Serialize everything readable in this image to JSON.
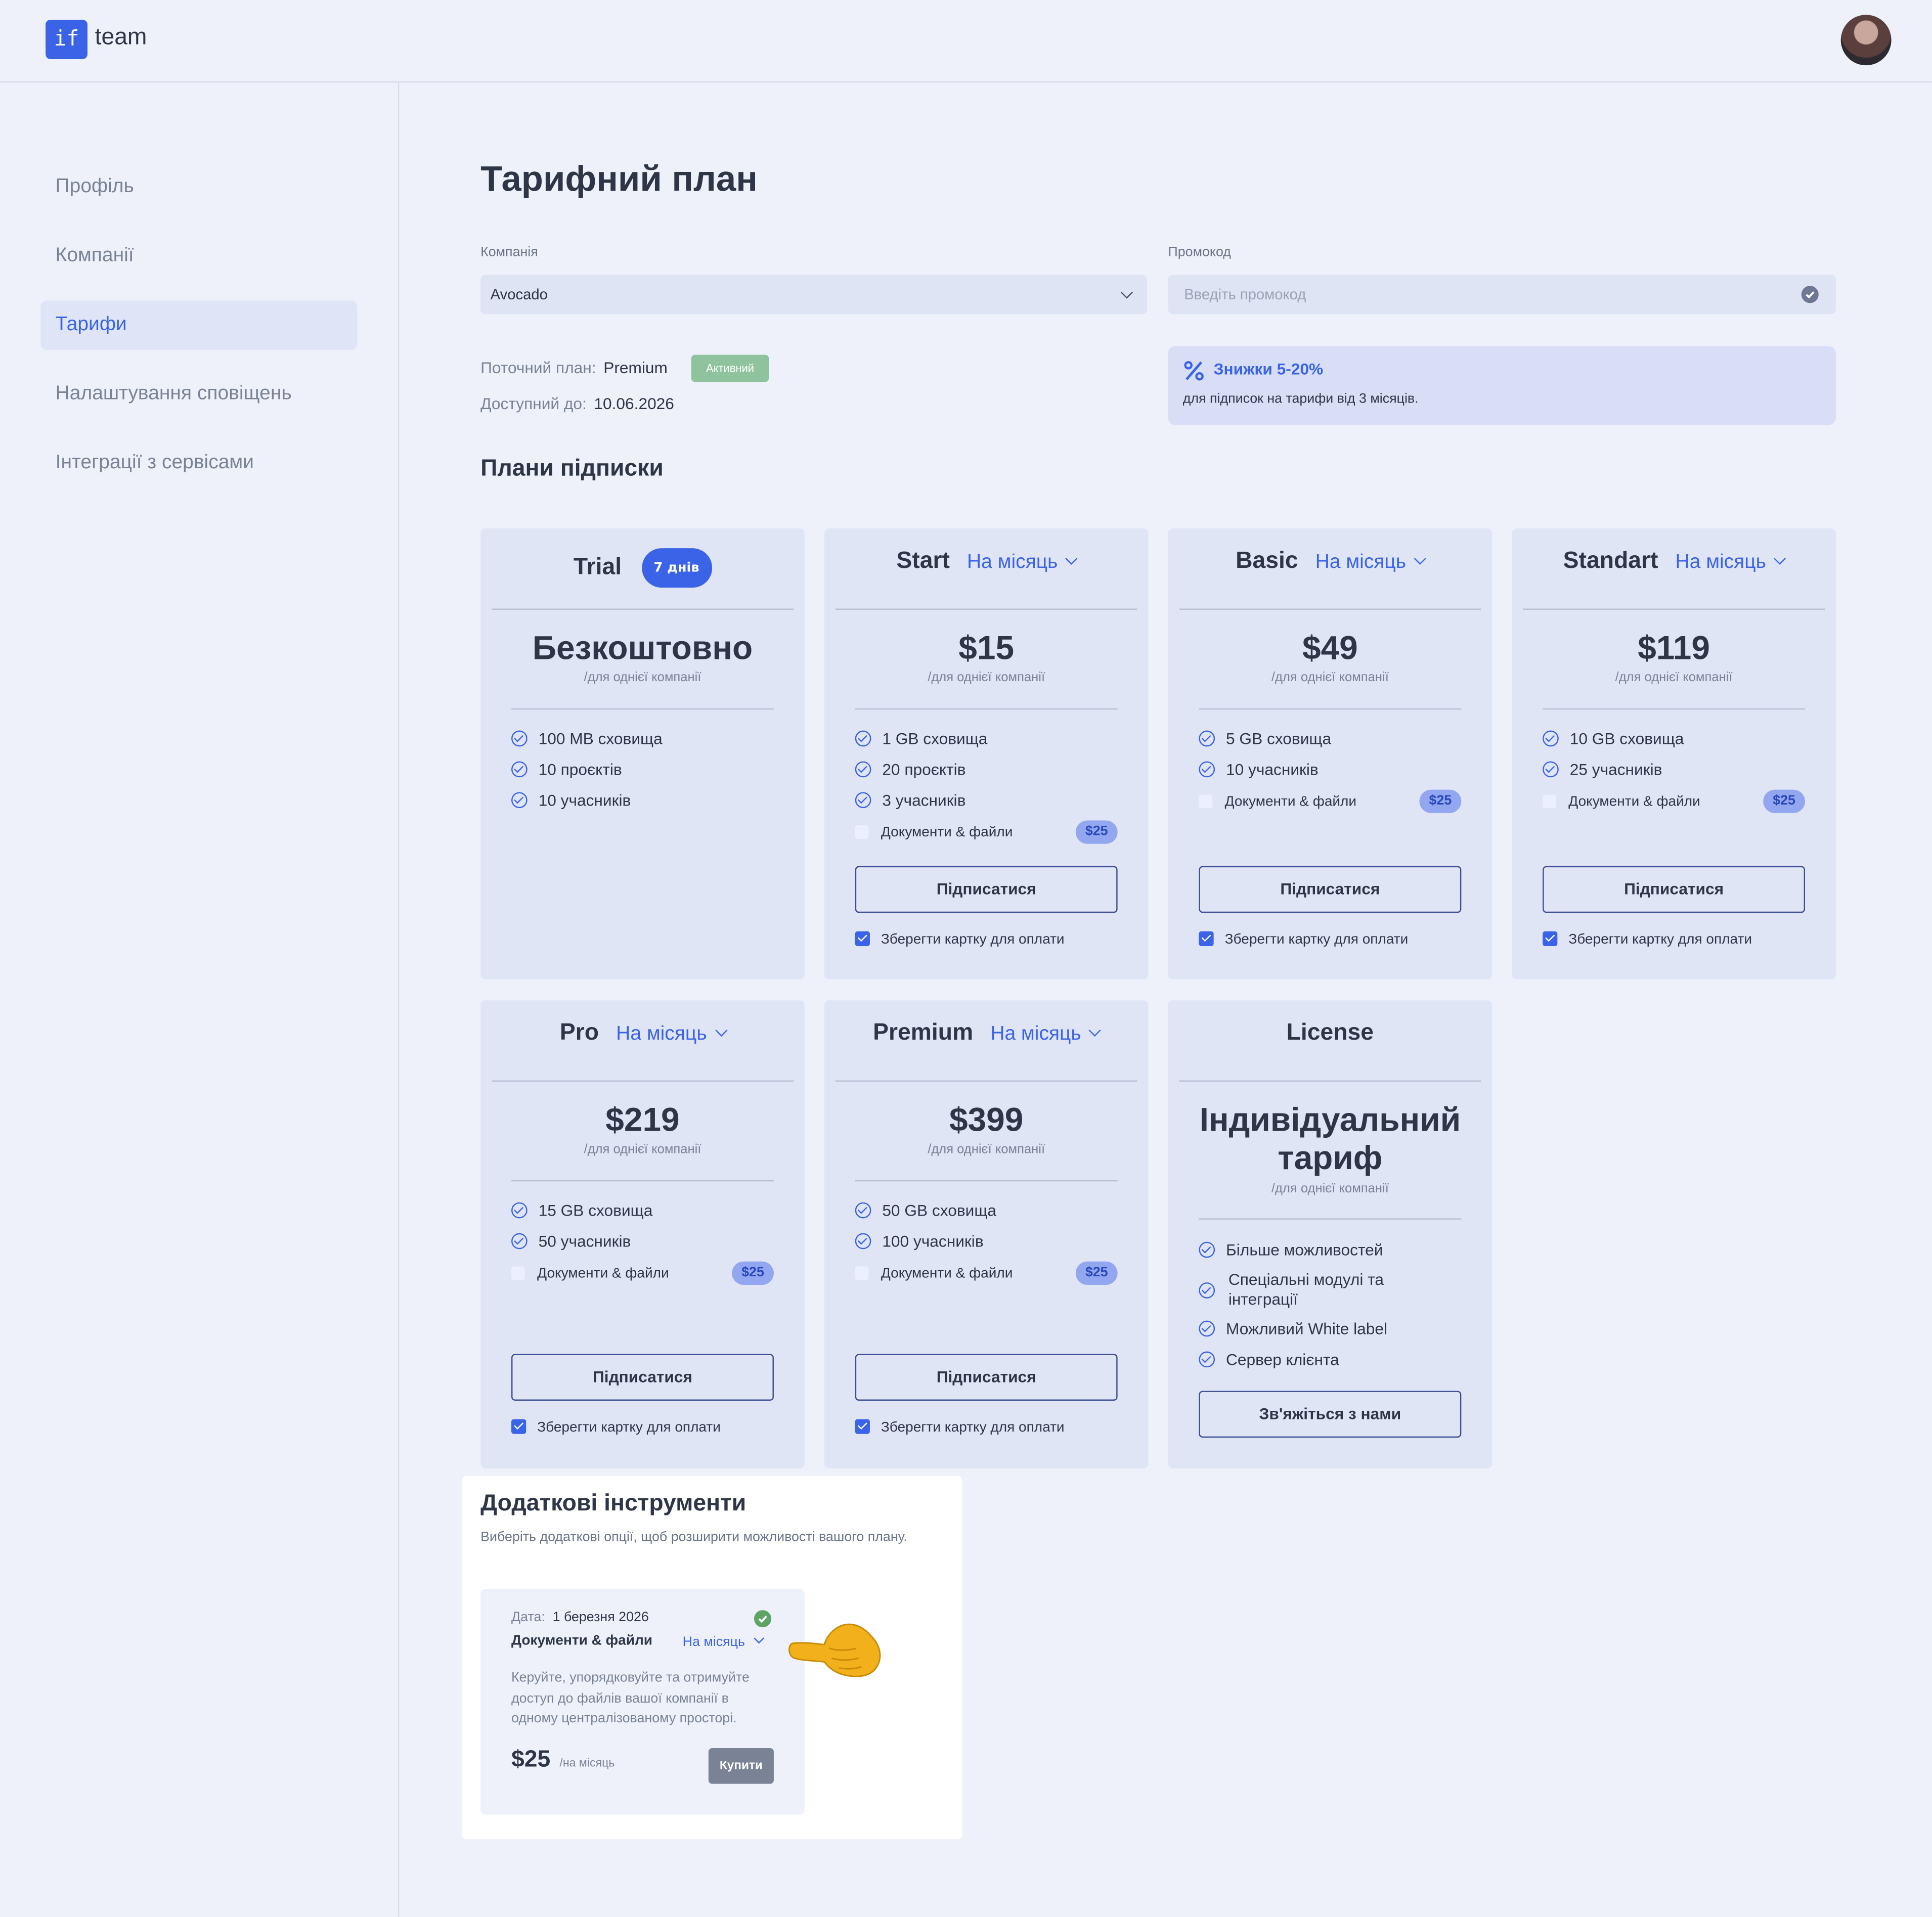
{
  "header": {
    "logo_mark": "if",
    "logo_text": "team"
  },
  "sidebar": {
    "items": [
      {
        "label": "Профіль"
      },
      {
        "label": "Компанії"
      },
      {
        "label": "Тарифи"
      },
      {
        "label": "Налаштування сповіщень"
      },
      {
        "label": "Інтеграції з сервісами"
      }
    ]
  },
  "main": {
    "title": "Тарифний план",
    "company_label": "Компанія",
    "company_value": "Avocado",
    "promo_label": "Промокод",
    "promo_placeholder": "Введіть промокод",
    "current_plan_label": "Поточний план:",
    "current_plan_value": "Premium",
    "active_badge": "Активний",
    "available_label": "Доступний до:",
    "available_value": "10.06.2026",
    "discount_title": "Знижки 5-20%",
    "discount_text": "для підписок на тарифи від 3 місяців.",
    "plans_title": "Плани підписки"
  },
  "plans": {
    "per_company": "/для однієї компанії",
    "period": "На місяць",
    "docs_label": "Документи & файли",
    "docs_price": "$25",
    "subscribe_label": "Підписатися",
    "save_card_label": "Зберегти картку для оплати",
    "trial": {
      "name": "Trial",
      "badge": "7 днів",
      "price": "Безкоштовно",
      "features": [
        "100 MB сховища",
        "10 проєктів",
        "10 учасників"
      ]
    },
    "start": {
      "name": "Start",
      "price": "$15",
      "features": [
        "1 GB сховища",
        "20 проєктів",
        "3 учасників"
      ]
    },
    "basic": {
      "name": "Basic",
      "price": "$49",
      "features": [
        "5 GB сховища",
        "10 учасників"
      ]
    },
    "standart": {
      "name": "Standart",
      "price": "$119",
      "features": [
        "10 GB сховища",
        "25 учасників"
      ]
    },
    "pro": {
      "name": "Pro",
      "price": "$219",
      "features": [
        "15 GB сховища",
        "50 учасників"
      ]
    },
    "premium": {
      "name": "Premium",
      "price": "$399",
      "features": [
        "50 GB сховища",
        "100 учасників"
      ]
    },
    "license": {
      "name": "License",
      "price_line1": "Індивідуальний",
      "price_line2": "тариф",
      "features": [
        "Більше можливостей",
        "Спеціальні модулі та",
        "інтеграції",
        "Можливий White label",
        "Сервер клієнта"
      ],
      "contact_label": "Зв'яжіться з нами"
    }
  },
  "addons": {
    "title": "Додаткові інструменти",
    "subtitle": "Виберіть додаткові опції, щоб розширити можливості вашого плану.",
    "item": {
      "date_label": "Дата:",
      "date_value": "1 березня 2026",
      "name": "Документи & файли",
      "period": "На місяць",
      "desc_lines": [
        "Керуйте, упорядковуйте та отримуйте",
        "доступ до файлів вашої компанії в",
        "одному централізованому просторі."
      ],
      "price": "$25",
      "price_unit": "/на місяць",
      "buy_label": "Купити"
    }
  },
  "colors": {
    "accent": "#3a63e8",
    "background": "#eef1fa",
    "card": "#e0e5f6",
    "active_badge": "#8fc39e"
  }
}
